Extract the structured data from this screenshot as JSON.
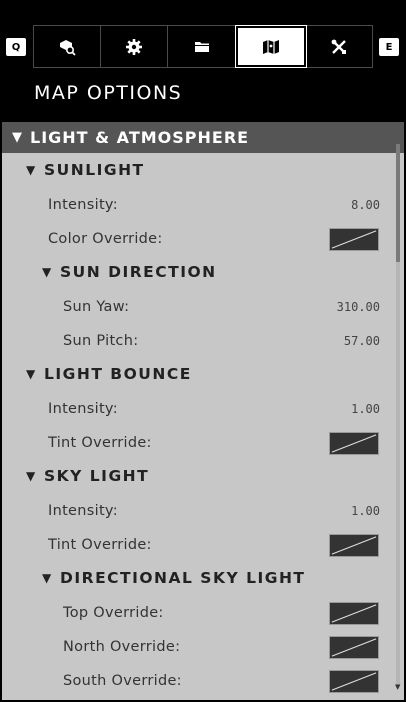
{
  "keys": {
    "left": "Q",
    "right": "E"
  },
  "tabs": [
    {
      "icon": "search-box-icon",
      "active": false
    },
    {
      "icon": "gear-icon",
      "active": false
    },
    {
      "icon": "folder-icon",
      "active": false
    },
    {
      "icon": "map-icon",
      "active": true
    },
    {
      "icon": "tools-icon",
      "active": false
    }
  ],
  "title": "MAP OPTIONS",
  "section": {
    "label": "LIGHT & ATMOSPHERE"
  },
  "sunlight": {
    "title": "SUNLIGHT",
    "intensity_label": "Intensity:",
    "intensity_value": "8.00",
    "color_override_label": "Color Override:"
  },
  "sun_direction": {
    "title": "SUN DIRECTION",
    "yaw_label": "Sun Yaw:",
    "yaw_value": "310.00",
    "pitch_label": "Sun Pitch:",
    "pitch_value": "57.00"
  },
  "light_bounce": {
    "title": "LIGHT BOUNCE",
    "intensity_label": "Intensity:",
    "intensity_value": "1.00",
    "tint_override_label": "Tint Override:"
  },
  "sky_light": {
    "title": "SKY LIGHT",
    "intensity_label": "Intensity:",
    "intensity_value": "1.00",
    "tint_override_label": "Tint Override:"
  },
  "directional_sky_light": {
    "title": "DIRECTIONAL SKY LIGHT",
    "top_override_label": "Top Override:",
    "north_override_label": "North Override:",
    "south_override_label": "South Override:"
  }
}
